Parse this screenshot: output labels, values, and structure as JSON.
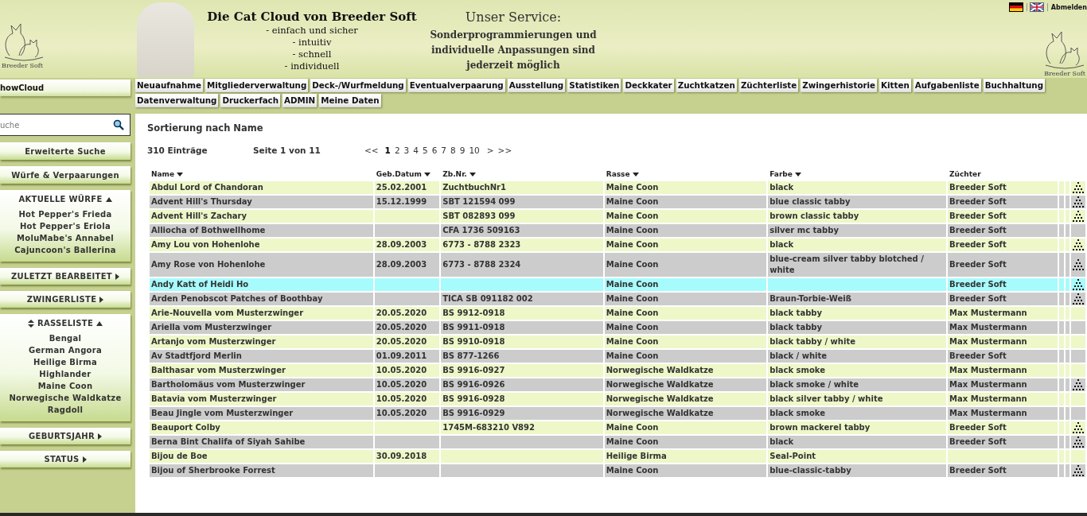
{
  "header": {
    "logo_left_text": "Breeder Soft",
    "title": "Die Cat Cloud von Breeder Soft",
    "slogans": [
      "- einfach und sicher",
      "- intuitiv",
      "- schnell",
      "- individuell"
    ],
    "service_title": "Unser Service:",
    "service_text": "Sonderprogrammierungen und individuelle Anpassungen sind jederzeit möglich",
    "languages": [
      {
        "kind": "de",
        "selected": true
      },
      {
        "kind": "en",
        "selected": false
      }
    ],
    "logout": "Abmelden",
    "logo_right_text": "Breeder Soft"
  },
  "nav": {
    "app_name": "howCloud",
    "items": [
      "Neuaufnahme",
      "Mitgliederverwaltung",
      "Deck-/Wurfmeldung",
      "Eventualverpaarung",
      "Ausstellung",
      "Statistiken",
      "Deckkater",
      "Zuchtkatzen",
      "Züchterliste",
      "Zwingerhistorie",
      "Kitten",
      "Aufgabenliste",
      "Buchhaltung",
      "Datenverwaltung",
      "Druckerfach",
      "ADMIN",
      "Meine Daten"
    ]
  },
  "sidebar": {
    "search": {
      "placeholder": "uche"
    },
    "blocks": [
      {
        "kind": "button",
        "label": "Erweiterte Suche"
      },
      {
        "kind": "button",
        "label": "Würfe & Verpaarungen"
      },
      {
        "kind": "section",
        "label": "AKTUELLE WÜRFE",
        "expanded": true,
        "sort_icon": false,
        "items": [
          "Hot Pepper's Frieda",
          "Hot Pepper's Eriola",
          "MoluMabe's Annabel",
          "Cajuncoon's Ballerina"
        ]
      },
      {
        "kind": "section",
        "label": "ZULETZT BEARBEITET",
        "expanded": false,
        "sort_icon": false
      },
      {
        "kind": "section",
        "label": "ZWINGERLISTE",
        "expanded": false,
        "sort_icon": false
      },
      {
        "kind": "section",
        "label": "RASSELISTE",
        "expanded": true,
        "sort_icon": true,
        "items": [
          "Bengal",
          "German Angora",
          "Heilige Birma",
          "Highlander",
          "Maine Coon",
          "Norwegische Waldkatze",
          "Ragdoll"
        ]
      },
      {
        "kind": "section",
        "label": "GEBURTSJAHR",
        "expanded": false,
        "sort_icon": false
      },
      {
        "kind": "section",
        "label": "STATUS",
        "expanded": false,
        "sort_icon": false
      }
    ]
  },
  "main": {
    "title": "Sortierung nach Name",
    "count": "310 Einträge",
    "page_info": "Seite 1 von 11",
    "pagination": [
      {
        "label": "<<",
        "selected": false
      },
      {
        "label": "1",
        "selected": true
      },
      {
        "label": "2",
        "selected": false
      },
      {
        "label": "3",
        "selected": false
      },
      {
        "label": "4",
        "selected": false
      },
      {
        "label": "5",
        "selected": false
      },
      {
        "label": "6",
        "selected": false
      },
      {
        "label": "7",
        "selected": false
      },
      {
        "label": "8",
        "selected": false
      },
      {
        "label": "9",
        "selected": false
      },
      {
        "label": "10",
        "selected": false
      },
      {
        "label": ">",
        "selected": false
      },
      {
        "label": ">>",
        "selected": false
      }
    ],
    "columns": [
      {
        "label": "Name",
        "sortable": true
      },
      {
        "label": "Geb.Datum",
        "sortable": true
      },
      {
        "label": "Zb.Nr.",
        "sortable": true
      },
      {
        "label": "Rasse",
        "sortable": true
      },
      {
        "label": "Farbe",
        "sortable": true
      },
      {
        "label": "Züchter",
        "sortable": false
      }
    ],
    "rows": [
      {
        "name": "Abdul Lord of Chandoran",
        "date": "25.02.2001",
        "zb": "ZuchtbuchNr1",
        "rasse": "Maine Coon",
        "farbe": "black",
        "zuechter": "Breeder Soft",
        "pedigree": true,
        "selected": false
      },
      {
        "name": "Advent Hill's Thursday",
        "date": "15.12.1999",
        "zb": "SBT 121594 099",
        "rasse": "Maine Coon",
        "farbe": "blue classic tabby",
        "zuechter": "Breeder Soft",
        "pedigree": true,
        "selected": false
      },
      {
        "name": "Advent Hill's Zachary",
        "date": "",
        "zb": "SBT 082893 099",
        "rasse": "Maine Coon",
        "farbe": "brown classic tabby",
        "zuechter": "Breeder Soft",
        "pedigree": true,
        "selected": false
      },
      {
        "name": "Alliocha of Bothwellhome",
        "date": "",
        "zb": "CFA 1736 509163",
        "rasse": "Maine Coon",
        "farbe": "silver mc tabby",
        "zuechter": "Breeder Soft",
        "pedigree": false,
        "selected": false
      },
      {
        "name": "Amy Lou von Hohenlohe",
        "date": "28.09.2003",
        "zb": "6773 - 8788 2323",
        "rasse": "Maine Coon",
        "farbe": "black",
        "zuechter": "Breeder Soft",
        "pedigree": true,
        "selected": false
      },
      {
        "name": "Amy Rose von Hohenlohe",
        "date": "28.09.2003",
        "zb": "6773 - 8788 2324",
        "rasse": "Maine Coon",
        "farbe": "blue-cream silver tabby blotched / white",
        "zuechter": "Breeder Soft",
        "pedigree": true,
        "selected": false
      },
      {
        "name": "Andy Katt of Heidi Ho",
        "date": "",
        "zb": "",
        "rasse": "Maine Coon",
        "farbe": "",
        "zuechter": "Breeder Soft",
        "pedigree": true,
        "selected": true
      },
      {
        "name": "Arden Penobscot Patches of Boothbay",
        "date": "",
        "zb": "TICA SB 091182 002",
        "rasse": "Maine Coon",
        "farbe": "Braun-Torbie-Weiß",
        "zuechter": "Breeder Soft",
        "pedigree": true,
        "selected": false
      },
      {
        "name": "Arie-Nouvella vom Musterzwinger",
        "date": "20.05.2020",
        "zb": "BS 9912-0918",
        "rasse": "Maine Coon",
        "farbe": "black tabby",
        "zuechter": "Max Mustermann",
        "pedigree": false,
        "selected": false
      },
      {
        "name": "Ariella vom Musterzwinger",
        "date": "20.05.2020",
        "zb": "BS 9911-0918",
        "rasse": "Maine Coon",
        "farbe": "black tabby",
        "zuechter": "Max Mustermann",
        "pedigree": false,
        "selected": false
      },
      {
        "name": "Artanjo vom Musterzwinger",
        "date": "20.05.2020",
        "zb": "BS 9910-0918",
        "rasse": "Maine Coon",
        "farbe": "black tabby / white",
        "zuechter": "Max Mustermann",
        "pedigree": false,
        "selected": false
      },
      {
        "name": "Av Stadtfjord Merlin",
        "date": "01.09.2011",
        "zb": "BS 877-1266",
        "rasse": "Maine Coon",
        "farbe": "black / white",
        "zuechter": "Breeder Soft",
        "pedigree": false,
        "selected": false
      },
      {
        "name": "Balthasar vom Musterzwinger",
        "date": "10.05.2020",
        "zb": "BS 9916-0927",
        "rasse": "Norwegische Waldkatze",
        "farbe": "black smoke",
        "zuechter": "Max Mustermann",
        "pedigree": false,
        "selected": false
      },
      {
        "name": "Bartholomäus vom Musterzwinger",
        "date": "10.05.2020",
        "zb": "BS 9916-0926",
        "rasse": "Norwegische Waldkatze",
        "farbe": "black smoke / white",
        "zuechter": "Max Mustermann",
        "pedigree": true,
        "selected": false
      },
      {
        "name": "Batavia vom Musterzwinger",
        "date": "10.05.2020",
        "zb": "BS 9916-0928",
        "rasse": "Norwegische Waldkatze",
        "farbe": "black silver tabby / white",
        "zuechter": "Max Mustermann",
        "pedigree": false,
        "selected": false
      },
      {
        "name": "Beau Jingle vom Musterzwinger",
        "date": "10.05.2020",
        "zb": "BS 9916-0929",
        "rasse": "Norwegische Waldkatze",
        "farbe": "black smoke",
        "zuechter": "Max Mustermann",
        "pedigree": false,
        "selected": false
      },
      {
        "name": "Beauport Colby",
        "date": "",
        "zb": "1745M-683210 V892",
        "rasse": "Maine Coon",
        "farbe": "brown mackerel tabby",
        "zuechter": "Breeder Soft",
        "pedigree": true,
        "selected": false
      },
      {
        "name": "Berna Bint Chalifa of Siyah Sahibe",
        "date": "",
        "zb": "",
        "rasse": "Maine Coon",
        "farbe": "black",
        "zuechter": "Breeder Soft",
        "pedigree": true,
        "selected": false
      },
      {
        "name": "Bijou de Boe",
        "date": "30.09.2018",
        "zb": "",
        "rasse": "Heilige Birma",
        "farbe": "Seal-Point",
        "zuechter": "",
        "pedigree": false,
        "selected": false
      },
      {
        "name": "Bijou of Sherbrooke Forrest",
        "date": "",
        "zb": "",
        "rasse": "Maine Coon",
        "farbe": "blue-classic-tabby",
        "zuechter": "Breeder Soft",
        "pedigree": true,
        "selected": false
      }
    ]
  }
}
